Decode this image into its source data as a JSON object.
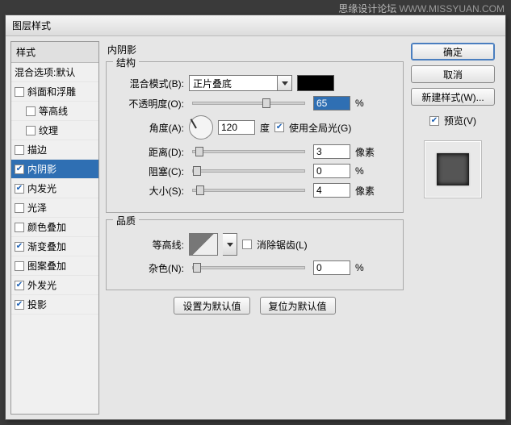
{
  "watermark": {
    "main": "思缘设计论坛",
    "sub": "WWW.MISSYUAN.COM"
  },
  "dialog_title": "图层样式",
  "styles": {
    "header": "样式",
    "blend_label": "混合选项:默认",
    "items": [
      {
        "label": "斜面和浮雕",
        "checked": false
      },
      {
        "label": "等高线",
        "checked": false,
        "sub": true
      },
      {
        "label": "纹理",
        "checked": false,
        "sub": true
      },
      {
        "label": "描边",
        "checked": false
      },
      {
        "label": "内阴影",
        "checked": true,
        "selected": true
      },
      {
        "label": "内发光",
        "checked": true
      },
      {
        "label": "光泽",
        "checked": false
      },
      {
        "label": "颜色叠加",
        "checked": false
      },
      {
        "label": "渐变叠加",
        "checked": true
      },
      {
        "label": "图案叠加",
        "checked": false
      },
      {
        "label": "外发光",
        "checked": true
      },
      {
        "label": "投影",
        "checked": true
      }
    ]
  },
  "panel_title": "内阴影",
  "groups": {
    "structure": {
      "legend": "结构",
      "blend_mode_label": "混合模式(B):",
      "blend_mode_value": "正片叠底",
      "swatch_color": "#000000",
      "opacity_label": "不透明度(O):",
      "opacity_value": "65",
      "opacity_unit": "%",
      "angle_label": "角度(A):",
      "angle_value": "120",
      "angle_unit": "度",
      "global_light_label": "使用全局光(G)",
      "global_light_checked": true,
      "distance_label": "距离(D):",
      "distance_value": "3",
      "distance_unit": "像素",
      "choke_label": "阻塞(C):",
      "choke_value": "0",
      "choke_unit": "%",
      "size_label": "大小(S):",
      "size_value": "4",
      "size_unit": "像素"
    },
    "quality": {
      "legend": "品质",
      "contour_label": "等高线:",
      "antialias_label": "消除锯齿(L)",
      "antialias_checked": false,
      "noise_label": "杂色(N):",
      "noise_value": "0",
      "noise_unit": "%"
    }
  },
  "buttons": {
    "set_default": "设置为默认值",
    "reset_default": "复位为默认值"
  },
  "right": {
    "ok": "确定",
    "cancel": "取消",
    "new_style": "新建样式(W)...",
    "preview_label": "预览(V)",
    "preview_checked": true
  }
}
